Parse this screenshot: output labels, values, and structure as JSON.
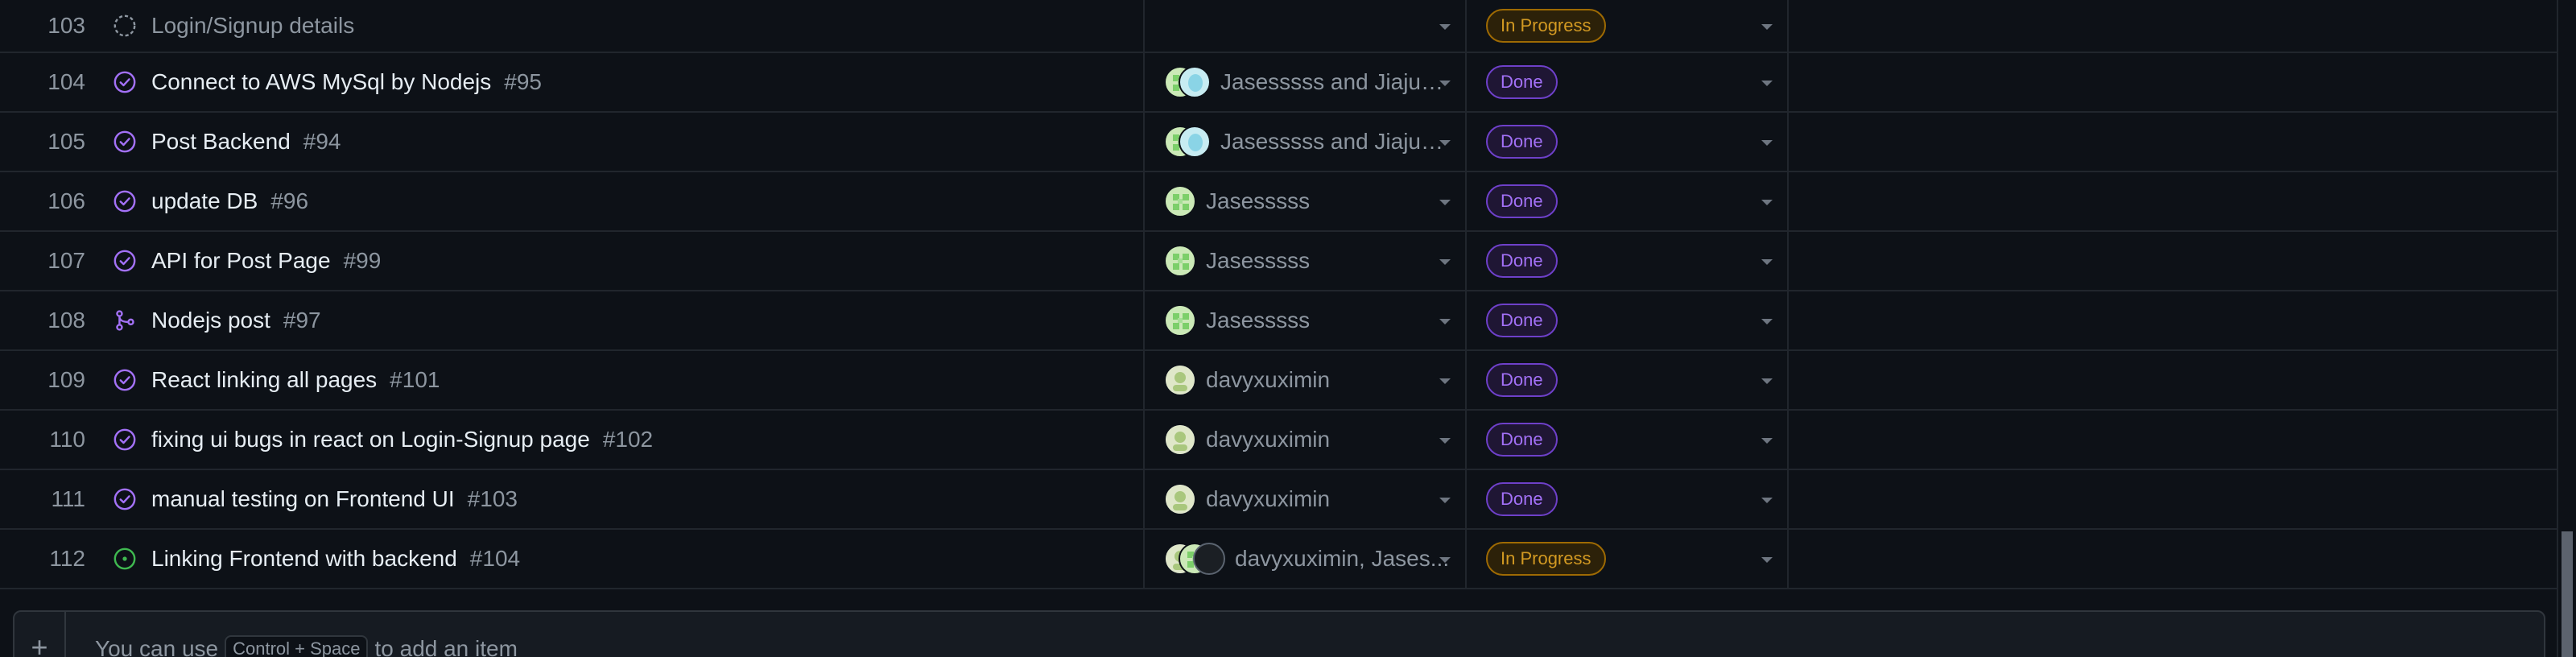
{
  "rows": [
    {
      "num": "103",
      "icon": "draft-issue-icon",
      "title": "Login/Signup details",
      "issue": "",
      "assignees": [],
      "assignee_text": "",
      "status": "In Progress",
      "status_type": "inprogress"
    },
    {
      "num": "104",
      "icon": "closed-issue-icon",
      "title": "Connect to AWS MySql by Nodejs",
      "issue": "#95",
      "assignees": [
        "green",
        "teal"
      ],
      "assignee_text": "Jasesssss and Jiajun...",
      "status": "Done",
      "status_type": "done"
    },
    {
      "num": "105",
      "icon": "closed-issue-icon",
      "title": "Post Backend",
      "issue": "#94",
      "assignees": [
        "green",
        "teal"
      ],
      "assignee_text": "Jasesssss and Jiajun...",
      "status": "Done",
      "status_type": "done"
    },
    {
      "num": "106",
      "icon": "closed-issue-icon",
      "title": "update DB",
      "issue": "#96",
      "assignees": [
        "green"
      ],
      "assignee_text": "Jasesssss",
      "status": "Done",
      "status_type": "done"
    },
    {
      "num": "107",
      "icon": "closed-issue-icon",
      "title": "API for Post Page",
      "issue": "#99",
      "assignees": [
        "green"
      ],
      "assignee_text": "Jasesssss",
      "status": "Done",
      "status_type": "done"
    },
    {
      "num": "108",
      "icon": "merged-pr-icon",
      "title": "Nodejs post",
      "issue": "#97",
      "assignees": [
        "green"
      ],
      "assignee_text": "Jasesssss",
      "status": "Done",
      "status_type": "done"
    },
    {
      "num": "109",
      "icon": "closed-issue-icon",
      "title": "React linking all pages",
      "issue": "#101",
      "assignees": [
        "face"
      ],
      "assignee_text": "davyxuximin",
      "status": "Done",
      "status_type": "done"
    },
    {
      "num": "110",
      "icon": "closed-issue-icon",
      "title": "fixing ui bugs in react on Login-Signup page",
      "issue": "#102",
      "assignees": [
        "face"
      ],
      "assignee_text": "davyxuximin",
      "status": "Done",
      "status_type": "done"
    },
    {
      "num": "111",
      "icon": "closed-issue-icon",
      "title": "manual testing on Frontend UI",
      "issue": "#103",
      "assignees": [
        "face"
      ],
      "assignee_text": "davyxuximin",
      "status": "Done",
      "status_type": "done"
    },
    {
      "num": "112",
      "icon": "open-issue-icon",
      "title": "Linking Frontend with backend",
      "issue": "#104",
      "assignees": [
        "face",
        "green",
        "dark"
      ],
      "assignee_text": "davyxuximin, Jases...",
      "status": "In Progress",
      "status_type": "inprogress"
    }
  ],
  "add_item": {
    "plus": "+",
    "hint_before": "You can use",
    "shortcut": "Control + Space",
    "hint_after": "to add an item"
  },
  "colors": {
    "done": "#a371f7",
    "in_progress": "#d29922",
    "open": "#3fb950",
    "background": "#0d1117"
  }
}
